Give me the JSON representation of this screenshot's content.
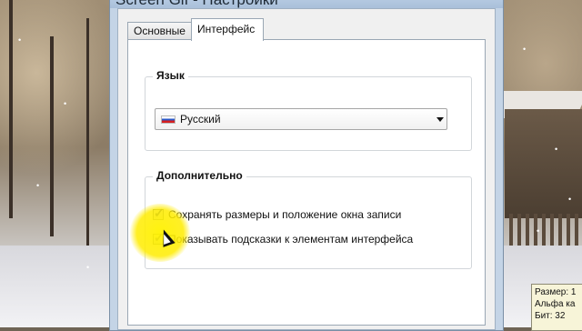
{
  "window": {
    "title": "Screen Gif - Настройки"
  },
  "tabs": [
    {
      "label": "Основные"
    },
    {
      "label": "Интерфейс"
    }
  ],
  "language_group": {
    "title": "Язык",
    "selected": "Русский"
  },
  "extra_group": {
    "title": "Дополнительно",
    "options": [
      {
        "label": "Сохранять размеры и положение окна записи",
        "checked": true
      },
      {
        "label": "Показывать подсказки к элементам интерфейса",
        "checked": true
      }
    ]
  },
  "tooltip": {
    "lines": [
      "Размер: 1",
      "Альфа ка",
      "Бит: 32"
    ]
  },
  "icons": {
    "flag": "russian-flag-icon",
    "dropdown": "chevron-down-icon",
    "check": "checkmark-icon",
    "cursor": "mouse-cursor-icon"
  },
  "colors": {
    "highlight": "#ffec00",
    "window_frame": "#c4d4e6"
  }
}
